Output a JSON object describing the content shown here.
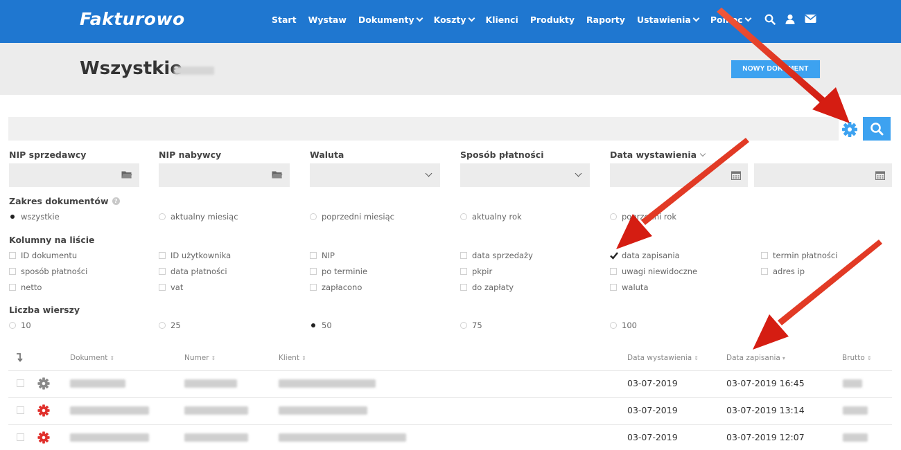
{
  "navbar": {
    "logo": "Fakturowo",
    "items": [
      {
        "label": "Start",
        "dropdown": false
      },
      {
        "label": "Wystaw",
        "dropdown": false
      },
      {
        "label": "Dokumenty",
        "dropdown": true
      },
      {
        "label": "Koszty",
        "dropdown": true
      },
      {
        "label": "Klienci",
        "dropdown": false
      },
      {
        "label": "Produkty",
        "dropdown": false
      },
      {
        "label": "Raporty",
        "dropdown": false
      },
      {
        "label": "Ustawienia",
        "dropdown": true
      },
      {
        "label": "Pomoc",
        "dropdown": true
      }
    ],
    "icons": [
      "search-icon",
      "user-icon",
      "envelope-icon"
    ]
  },
  "header": {
    "title": "Wszystkie",
    "new_document_button": "NOWY DOKUMENT"
  },
  "filters": {
    "nip_sprzedawcy": "NIP sprzedawcy",
    "nip_nabywcy": "NIP nabywcy",
    "waluta": "Waluta",
    "sposob_platnosci": "Sposób płatności",
    "data_wystawienia": "Data wystawienia"
  },
  "zakres": {
    "label": "Zakres dokumentów",
    "options": [
      "wszystkie",
      "aktualny miesiąc",
      "poprzedni miesiąc",
      "aktualny rok",
      "poprzedni rok"
    ],
    "selected": 0
  },
  "kolumny": {
    "label": "Kolumny na liście",
    "options": [
      {
        "label": "ID dokumentu",
        "checked": false
      },
      {
        "label": "ID użytkownika",
        "checked": false
      },
      {
        "label": "NIP",
        "checked": false
      },
      {
        "label": "data sprzedaży",
        "checked": false
      },
      {
        "label": "data zapisania",
        "checked": true
      },
      {
        "label": "termin płatności",
        "checked": false
      },
      {
        "label": "sposób płatności",
        "checked": false
      },
      {
        "label": "data płatności",
        "checked": false
      },
      {
        "label": "po terminie",
        "checked": false
      },
      {
        "label": "pkpir",
        "checked": false
      },
      {
        "label": "uwagi niewidoczne",
        "checked": false
      },
      {
        "label": "adres ip",
        "checked": false
      },
      {
        "label": "netto",
        "checked": false
      },
      {
        "label": "vat",
        "checked": false
      },
      {
        "label": "zapłacono",
        "checked": false
      },
      {
        "label": "do zapłaty",
        "checked": false
      },
      {
        "label": "waluta",
        "checked": false
      }
    ]
  },
  "wiersze": {
    "label": "Liczba wierszy",
    "options": [
      "10",
      "25",
      "50",
      "75",
      "100"
    ],
    "selected": 2
  },
  "table": {
    "headers": {
      "dokument": "Dokument",
      "numer": "Numer",
      "klient": "Klient",
      "data_wystawienia": "Data wystawienia",
      "data_zapisania": "Data zapisania",
      "brutto": "Brutto"
    },
    "rows": [
      {
        "data_wystawienia": "03-07-2019",
        "data_zapisania": "03-07-2019 16:45",
        "gear_color": "#8a8a8a"
      },
      {
        "data_wystawienia": "03-07-2019",
        "data_zapisania": "03-07-2019 13:14",
        "gear_color": "#e0302c"
      },
      {
        "data_wystawienia": "03-07-2019",
        "data_zapisania": "03-07-2019 12:07",
        "gear_color": "#e0302c"
      }
    ]
  },
  "colors": {
    "navbar": "#1f77d0",
    "accent": "#3da2f0",
    "arrow": "#e02a1a"
  }
}
